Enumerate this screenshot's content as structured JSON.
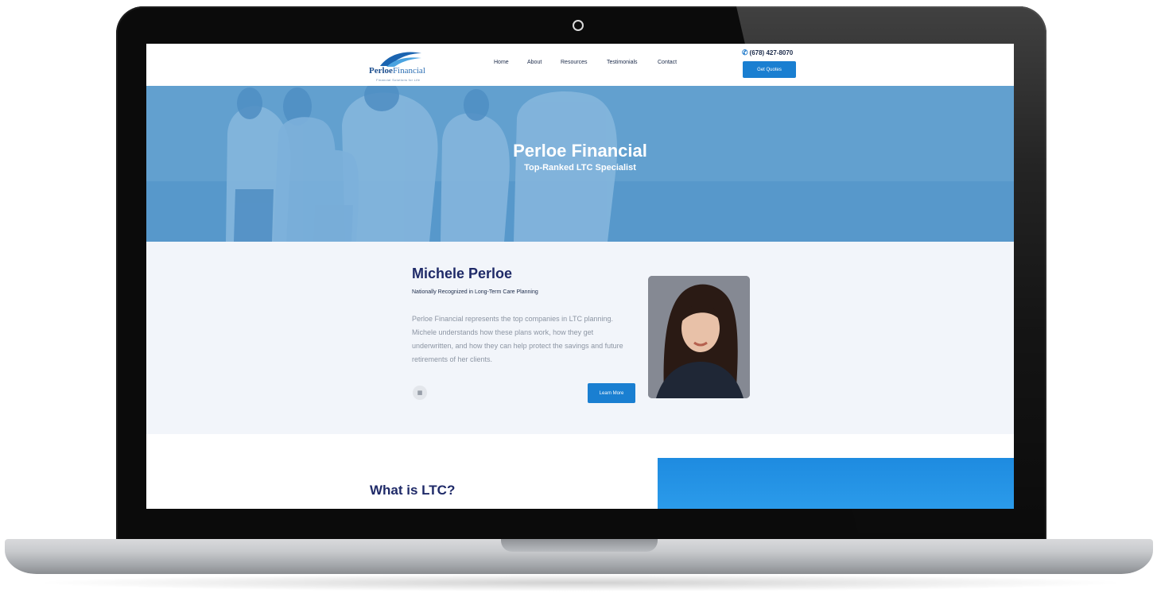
{
  "site": {
    "logo": {
      "name_bold": "Perloe",
      "name_regular": "Financial",
      "tagline": "Financial Solutions for Life"
    },
    "nav": [
      {
        "label": "Home"
      },
      {
        "label": "About"
      },
      {
        "label": "Resources"
      },
      {
        "label": "Testimonials"
      },
      {
        "label": "Contact"
      }
    ],
    "phone": "(678) 427-8070",
    "cta_label": "Get Quotes"
  },
  "hero": {
    "title": "Perloe Financial",
    "subtitle": "Top-Ranked LTC Specialist"
  },
  "about": {
    "name": "Michele Perloe",
    "subtitle": "Nationally Recognized in Long-Term Care Planning",
    "body": "Perloe Financial represents the top companies in LTC planning. Michele understands how these plans work, how they get underwritten, and how they can help protect the savings and future retirements of her clients.",
    "calendar_icon": "calendar-icon",
    "cta_label": "Learn More"
  },
  "ltc": {
    "title": "What is LTC?"
  },
  "colors": {
    "accent": "#1a7fd1",
    "heading": "#1f2a68",
    "hero_tint": "#6ea8d2",
    "about_bg": "#f2f5fa"
  }
}
